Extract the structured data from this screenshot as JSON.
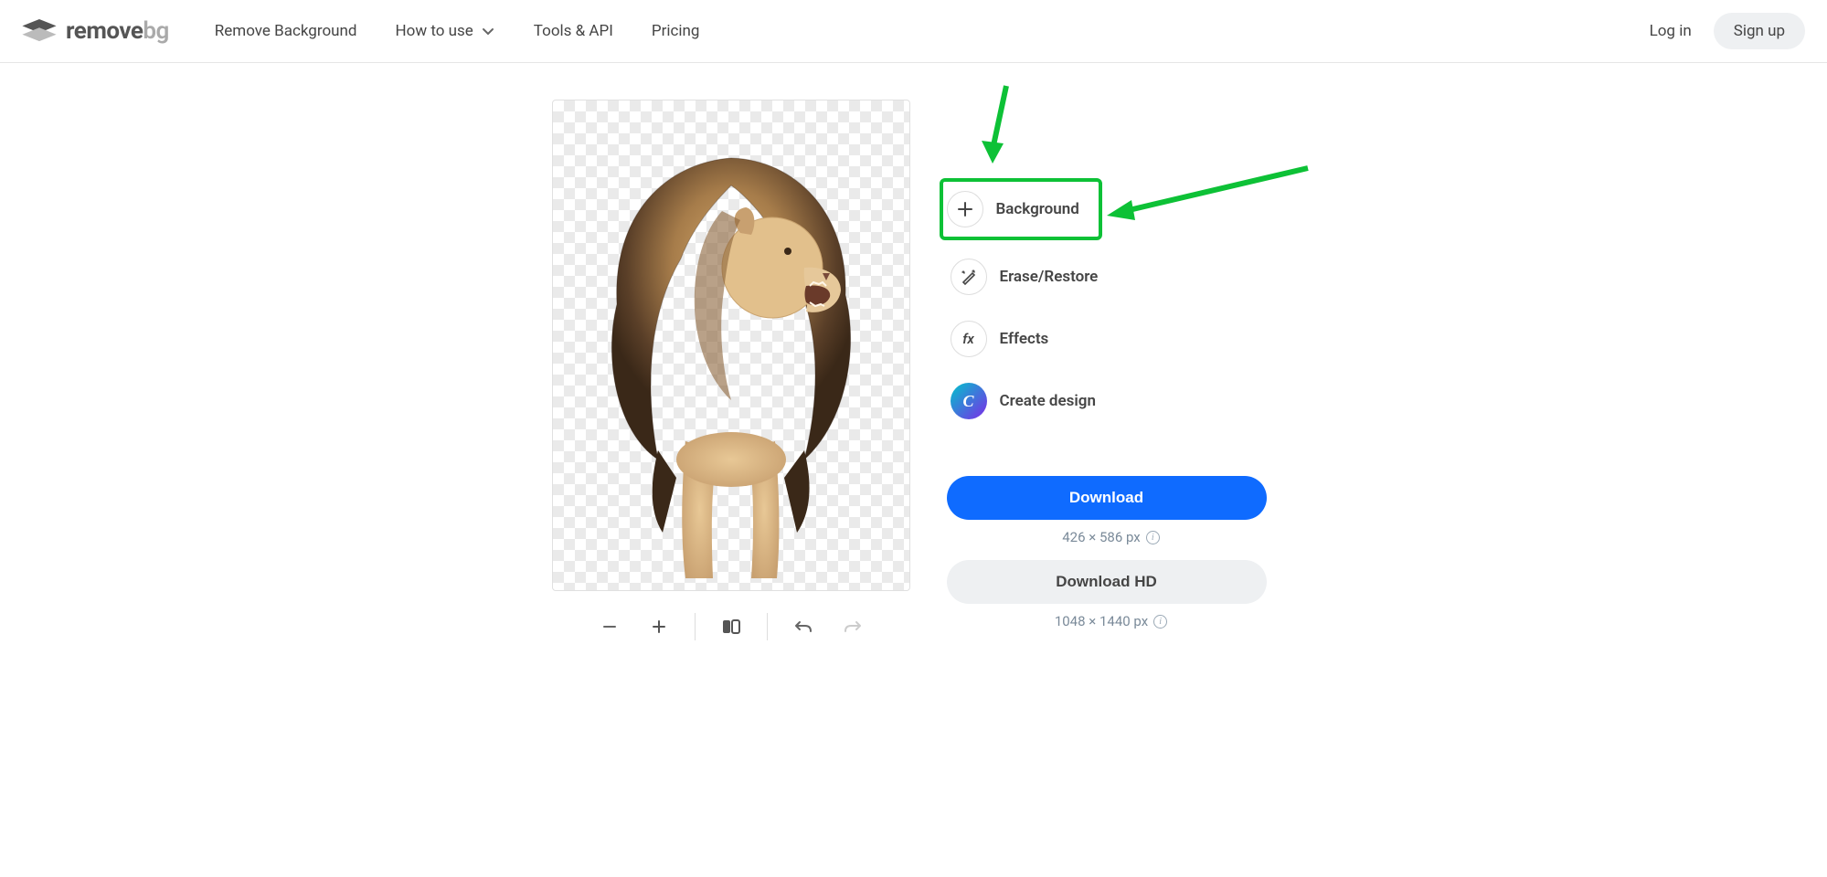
{
  "brand": {
    "name": "remove",
    "suffix": "bg"
  },
  "nav": {
    "remove_bg": "Remove Background",
    "how_to_use": "How to use",
    "tools_api": "Tools & API",
    "pricing": "Pricing"
  },
  "auth": {
    "login": "Log in",
    "signup": "Sign up"
  },
  "options": {
    "background": "Background",
    "erase_restore": "Erase/Restore",
    "effects": "Effects",
    "create_design": "Create design"
  },
  "download": {
    "primary_label": "Download",
    "primary_dim": "426 × 586 px",
    "hd_label": "Download HD",
    "hd_dim": "1048 × 1440 px"
  }
}
